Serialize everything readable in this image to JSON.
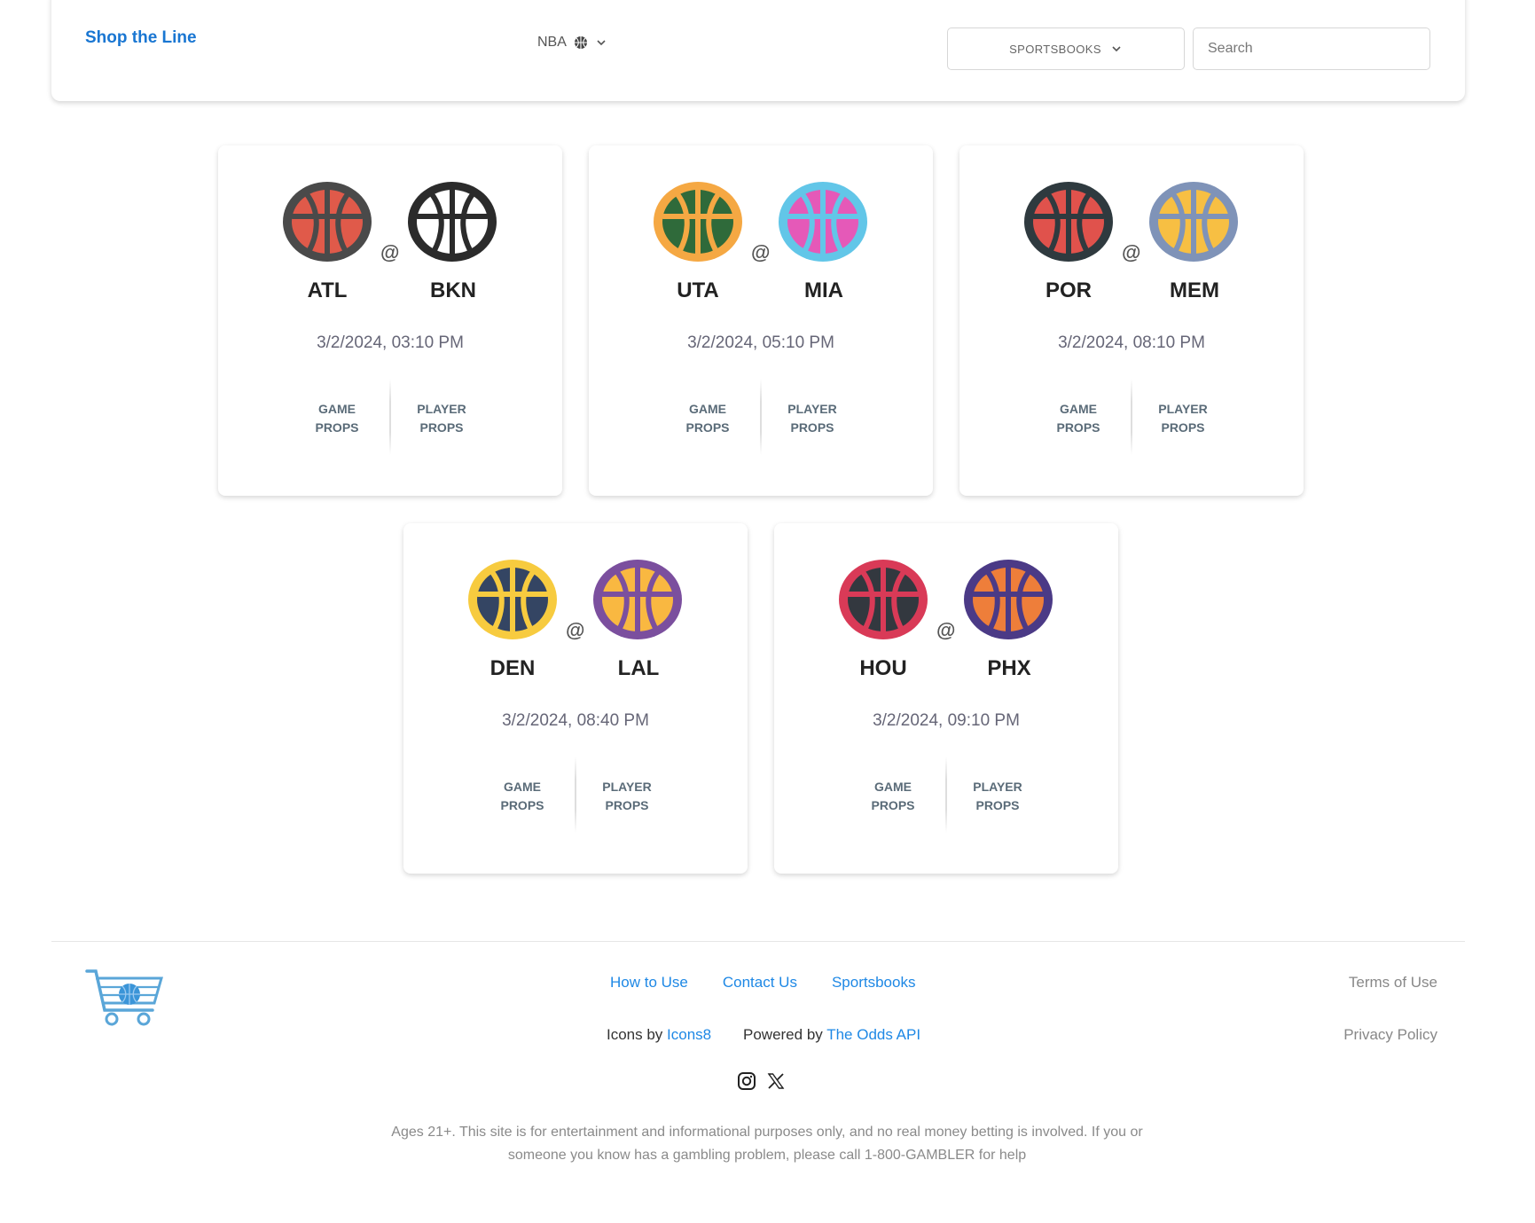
{
  "header": {
    "brand": "Shop the Line",
    "league": "NBA",
    "sportsbooks_label": "SPORTSBOOKS",
    "search_placeholder": "Search"
  },
  "at_symbol": "@",
  "game_props_label": "GAME PROPS",
  "player_props_label": "PLAYER PROPS",
  "games": [
    {
      "away": {
        "abbr": "ATL",
        "ring": "#4a4a4a",
        "fill": "#e05a4a",
        "lines": "#4a4a4a"
      },
      "home": {
        "abbr": "BKN",
        "ring": "#2b2b2b",
        "fill": "#ffffff",
        "lines": "#2b2b2b"
      },
      "datetime": "3/2/2024, 03:10 PM"
    },
    {
      "away": {
        "abbr": "UTA",
        "ring": "#f5a843",
        "fill": "#2f6a3a",
        "lines": "#f5a843"
      },
      "home": {
        "abbr": "MIA",
        "ring": "#62c6e8",
        "fill": "#e559b8",
        "lines": "#62c6e8"
      },
      "datetime": "3/2/2024, 05:10 PM"
    },
    {
      "away": {
        "abbr": "POR",
        "ring": "#2f3a3f",
        "fill": "#e0524c",
        "lines": "#2f3a3f"
      },
      "home": {
        "abbr": "MEM",
        "ring": "#7f93b8",
        "fill": "#f7bf43",
        "lines": "#7f93b8"
      },
      "datetime": "3/2/2024, 08:10 PM"
    },
    {
      "away": {
        "abbr": "DEN",
        "ring": "#f7cb3f",
        "fill": "#344563",
        "lines": "#f7cb3f"
      },
      "home": {
        "abbr": "LAL",
        "ring": "#7b4f9e",
        "fill": "#f9b841",
        "lines": "#7b4f9e"
      },
      "datetime": "3/2/2024, 08:40 PM"
    },
    {
      "away": {
        "abbr": "HOU",
        "ring": "#d93a57",
        "fill": "#33383f",
        "lines": "#d93a57"
      },
      "home": {
        "abbr": "PHX",
        "ring": "#4b3a86",
        "fill": "#ee7e3a",
        "lines": "#4b3a86"
      },
      "datetime": "3/2/2024, 09:10 PM"
    }
  ],
  "footer": {
    "nav": [
      "How to Use",
      "Contact Us",
      "Sportsbooks"
    ],
    "icons_by_prefix": "Icons by ",
    "icons_by_link": "Icons8",
    "powered_by_prefix": "Powered by ",
    "powered_by_link": "The Odds API",
    "terms": "Terms of Use",
    "privacy": "Privacy Policy",
    "social": [
      "instagram-icon",
      "x-icon"
    ],
    "disclaimer": "Ages 21+. This site is for entertainment and informational purposes only, and no real money betting is involved. If you or someone you know has a gambling problem, please call 1-800-GAMBLER for help"
  }
}
